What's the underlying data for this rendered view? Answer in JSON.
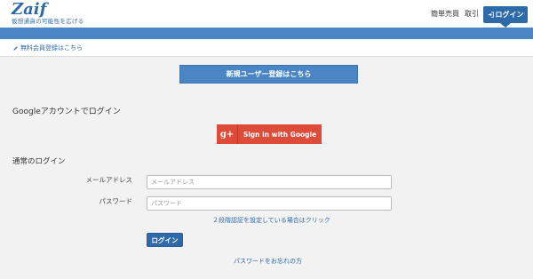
{
  "header": {
    "logo_text": "Zaif",
    "tagline": "仮想通貨の可能性を広げる",
    "nav": {
      "quick_trade": "簡単売買",
      "trade": "取引",
      "login": "ログイン"
    }
  },
  "subnav": {
    "signup_free": "無料会員登録はこちら"
  },
  "main": {
    "register_button": "新規ユーザー登録はこちら",
    "google_heading": "Googleアカウントでログイン",
    "google_button": "Sign in with Google",
    "google_icon": "g+",
    "normal_heading": "通常のログイン",
    "email_label": "メールアドレス",
    "email_placeholder": "メールアドレス",
    "password_label": "パスワード",
    "password_placeholder": "パスワード",
    "twofa_link": "２段階認証を設定している場合はクリック",
    "login_button": "ログイン",
    "forgot_link": "パスワードをお忘れの方"
  },
  "colors": {
    "brand": "#2e6aa8",
    "band": "#4a86c5",
    "google": "#dd4b39"
  }
}
